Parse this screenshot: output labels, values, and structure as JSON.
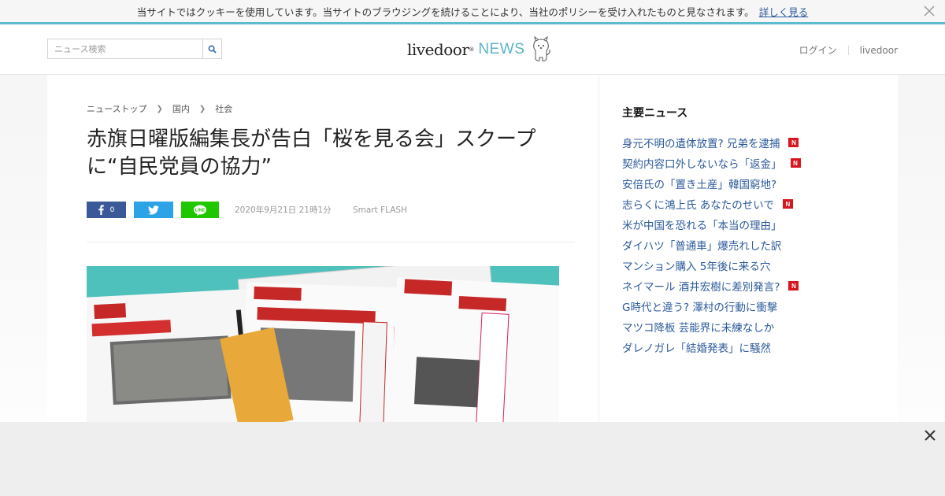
{
  "cookie_bar": {
    "text": "当サイトではクッキーを使用しています。当サイトのブラウジングを続けることにより、当社のポリシーを受け入れたものと見なされます。",
    "link": "詳しく見る"
  },
  "header": {
    "search_placeholder": "ニュース検索",
    "logo_main": "livedoor",
    "logo_reg": "®",
    "logo_news": "NEWS",
    "login": "ログイン",
    "livedoor_link": "livedoor"
  },
  "breadcrumb": [
    "ニューストップ",
    "国内",
    "社会"
  ],
  "article": {
    "title": "赤旗日曜版編集長が告白「桜を見る会」スクープに“自民党員の協力”",
    "fb_count": "0",
    "date": "2020年9月21日 21時1分",
    "source": "Smart FLASH"
  },
  "sidebar": {
    "heading": "主要ニュース",
    "items": [
      {
        "text": "身元不明の遺体放置? 兄弟を逮捕",
        "new": true
      },
      {
        "text": "契約内容口外しないなら「返金」",
        "new": true
      },
      {
        "text": "安倍氏の「置き土産」韓国窮地?",
        "new": false
      },
      {
        "text": "志らくに鴻上氏 あなたのせいで",
        "new": true
      },
      {
        "text": "米が中国を恐れる「本当の理由」",
        "new": false
      },
      {
        "text": "ダイハツ「普通車」爆売れした訳",
        "new": false
      },
      {
        "text": "マンション購入 5年後に来る穴",
        "new": false
      },
      {
        "text": "ネイマール 酒井宏樹に差別発言?",
        "new": true
      },
      {
        "text": "G時代と違う? 澤村の行動に衝撃",
        "new": false
      },
      {
        "text": "マツコ降板 芸能界に未練なしか",
        "new": false
      },
      {
        "text": "ダレノガレ「結婚発表」に騒然",
        "new": false
      }
    ],
    "badge": "N"
  },
  "colors": {
    "accent": "#5bbccf",
    "link": "#2c5a9b",
    "facebook": "#3b5998",
    "twitter": "#2ba3e6",
    "line": "#1fc700",
    "badge": "#d7171f"
  }
}
